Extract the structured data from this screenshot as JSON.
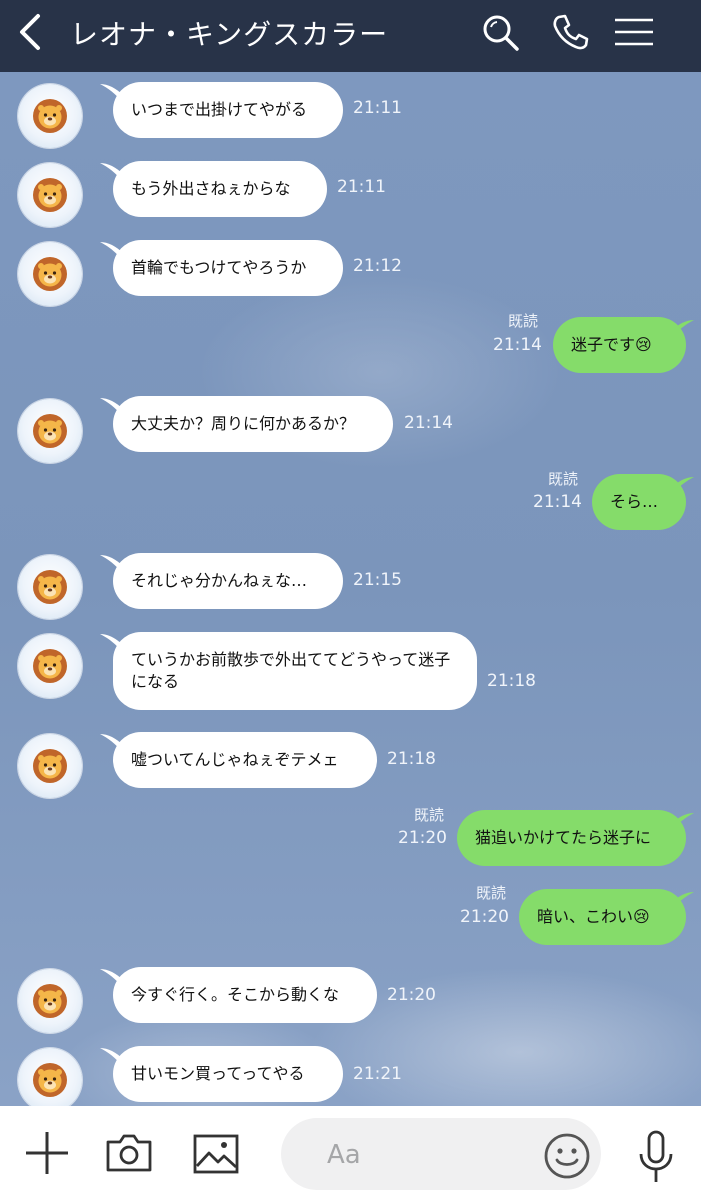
{
  "header": {
    "title": "レオナ・キングスカラー",
    "icons": [
      "back-icon",
      "search-icon",
      "phone-icon",
      "menu-icon"
    ]
  },
  "messages": [
    {
      "side": "in",
      "text": "いつまで出掛けてやがる",
      "time": "21:11"
    },
    {
      "side": "in",
      "text": "もう外出さねぇからな",
      "time": "21:11"
    },
    {
      "side": "in",
      "text": "首輪でもつけてやろうか",
      "time": "21:12"
    },
    {
      "side": "out",
      "text": "迷子です😢",
      "time": "21:14",
      "read": "既読"
    },
    {
      "side": "in",
      "text": "大丈夫か？周りに何かあるか？",
      "time": "21:14"
    },
    {
      "side": "out",
      "text": "そら…",
      "time": "21:14",
      "read": "既読"
    },
    {
      "side": "in",
      "text": "それじゃ分かんねぇな…",
      "time": "21:15"
    },
    {
      "side": "in",
      "text": "ていうかお前散歩で外出ててどうやって迷子になる",
      "time": "21:18"
    },
    {
      "side": "in",
      "text": "嘘ついてんじゃねぇぞテメェ",
      "time": "21:18"
    },
    {
      "side": "out",
      "text": "猫追いかけてたら迷子に",
      "time": "21:20",
      "read": "既読"
    },
    {
      "side": "out",
      "text": "暗い、こわい😢",
      "time": "21:20",
      "read": "既読"
    },
    {
      "side": "in",
      "text": "今すぐ行く。そこから動くな",
      "time": "21:20"
    },
    {
      "side": "in",
      "text": "甘いモン買ってってやる",
      "time": "21:21"
    }
  ],
  "footer": {
    "input_placeholder": "Aa",
    "icons": [
      "plus-icon",
      "camera-icon",
      "image-icon",
      "emoji-icon",
      "mic-icon"
    ]
  },
  "colors": {
    "header_bg": "#283348",
    "chat_bg": "#7f98bd",
    "incoming_bubble": "#ffffff",
    "outgoing_bubble": "#85dc6a"
  }
}
